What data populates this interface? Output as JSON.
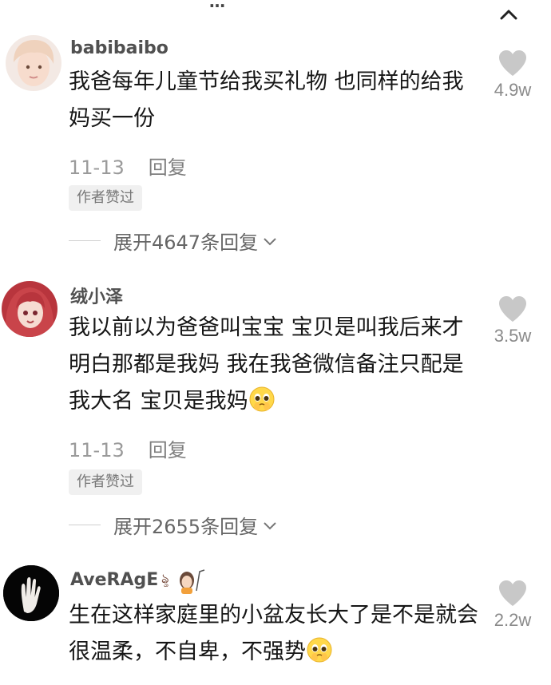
{
  "header": {
    "title": "…"
  },
  "comments": [
    {
      "username": "babibaibo",
      "content": "我爸每年儿童节给我买礼物 也同样的给我妈买一份",
      "date": "11-13",
      "reply_label": "回复",
      "badge": "作者赞过",
      "expand_label": "展开4647条回复",
      "likes": "4.9w"
    },
    {
      "username": "绒小泽",
      "content": "我以前以为爸爸叫宝宝 宝贝是叫我后来才明白那都是我妈 我在我爸微信备注只配是我大名 宝贝是我妈",
      "date": "11-13",
      "reply_label": "回复",
      "badge": "作者赞过",
      "expand_label": "展开2655条回复",
      "likes": "3.5w"
    },
    {
      "username": "AveRAgE",
      "content": "生在这样家庭里的小盆友长大了是不是就会很温柔，不自卑，不强势",
      "likes": "2.2w"
    }
  ],
  "icons": {
    "like": "heart-icon",
    "collapse": "chevron-up-icon",
    "expand": "chevron-down-icon",
    "emoji": "pleading-face-icon"
  },
  "colors": {
    "text": "#161616",
    "muted": "#9a9a9a",
    "heart": "#c8c8c8"
  }
}
